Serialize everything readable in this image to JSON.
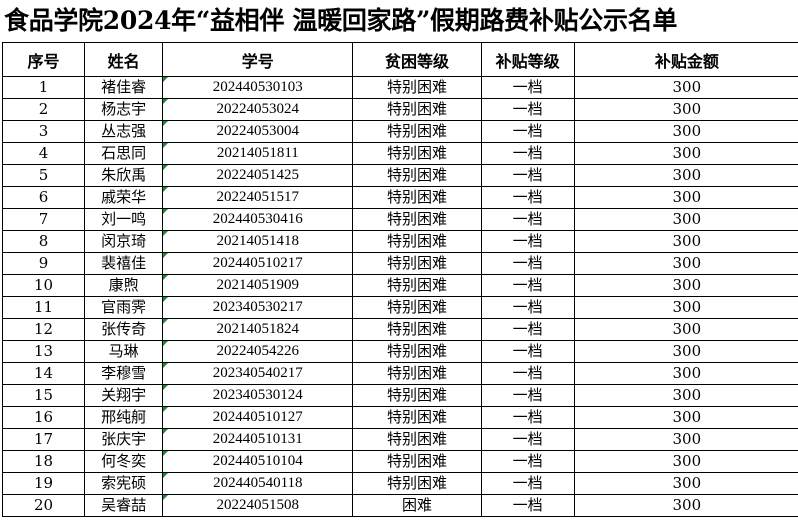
{
  "title": "食品学院2024年“益相伴 温暖回家路”假期路费补贴公示名单",
  "columns": [
    "序号",
    "姓名",
    "学号",
    "贫困等级",
    "补贴等级",
    "补贴金额"
  ],
  "rows": [
    {
      "no": "1",
      "name": "褚佳睿",
      "id": "202440530103",
      "poverty": "特别困难",
      "level": "一档",
      "amount": "300"
    },
    {
      "no": "2",
      "name": "杨志宇",
      "id": "20224053024",
      "poverty": "特别困难",
      "level": "一档",
      "amount": "300"
    },
    {
      "no": "3",
      "name": "丛志强",
      "id": "20224053004",
      "poverty": "特别困难",
      "level": "一档",
      "amount": "300"
    },
    {
      "no": "4",
      "name": "石思同",
      "id": "20214051811",
      "poverty": "特别困难",
      "level": "一档",
      "amount": "300"
    },
    {
      "no": "5",
      "name": "朱欣禹",
      "id": "20224051425",
      "poverty": "特别困难",
      "level": "一档",
      "amount": "300"
    },
    {
      "no": "6",
      "name": "戚荣华",
      "id": "20224051517",
      "poverty": "特别困难",
      "level": "一档",
      "amount": "300"
    },
    {
      "no": "7",
      "name": "刘一鸣",
      "id": "202440530416",
      "poverty": "特别困难",
      "level": "一档",
      "amount": "300"
    },
    {
      "no": "8",
      "name": "闵京琦",
      "id": "20214051418",
      "poverty": "特别困难",
      "level": "一档",
      "amount": "300"
    },
    {
      "no": "9",
      "name": "裴禧佳",
      "id": "202440510217",
      "poverty": "特别困难",
      "level": "一档",
      "amount": "300"
    },
    {
      "no": "10",
      "name": "康煦",
      "id": "20214051909",
      "poverty": "特别困难",
      "level": "一档",
      "amount": "300"
    },
    {
      "no": "11",
      "name": "官雨霁",
      "id": "202340530217",
      "poverty": "特别困难",
      "level": "一档",
      "amount": "300"
    },
    {
      "no": "12",
      "name": "张传奇",
      "id": "20214051824",
      "poverty": "特别困难",
      "level": "一档",
      "amount": "300"
    },
    {
      "no": "13",
      "name": "马琳",
      "id": "20224054226",
      "poverty": "特别困难",
      "level": "一档",
      "amount": "300"
    },
    {
      "no": "14",
      "name": "李穆雪",
      "id": "202340540217",
      "poverty": "特别困难",
      "level": "一档",
      "amount": "300"
    },
    {
      "no": "15",
      "name": "关翔宇",
      "id": "202340530124",
      "poverty": "特别困难",
      "level": "一档",
      "amount": "300"
    },
    {
      "no": "16",
      "name": "邢纯舸",
      "id": "202440510127",
      "poverty": "特别困难",
      "level": "一档",
      "amount": "300"
    },
    {
      "no": "17",
      "name": "张庆宇",
      "id": "202440510131",
      "poverty": "特别困难",
      "level": "一档",
      "amount": "300"
    },
    {
      "no": "18",
      "name": "何冬奕",
      "id": "202440510104",
      "poverty": "特别困难",
      "level": "一档",
      "amount": "300"
    },
    {
      "no": "19",
      "name": "索宪硕",
      "id": "202440540118",
      "poverty": "特别困难",
      "level": "一档",
      "amount": "300"
    },
    {
      "no": "20",
      "name": "吴睿喆",
      "id": "20224051508",
      "poverty": "困难",
      "level": "一档",
      "amount": "300"
    }
  ],
  "colors": {
    "border": "#000000",
    "comment_marker": "#1a8a3a"
  }
}
